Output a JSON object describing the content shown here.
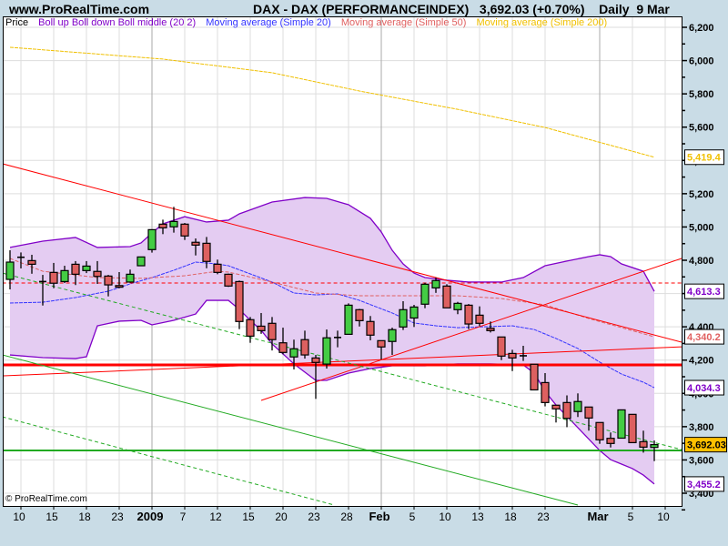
{
  "header": {
    "site": "www.ProRealTime.com",
    "instrument": "DAX - DAX (PERFORMANCEINDEX)",
    "quote": "3,692.03 (+0.70%)",
    "period": "Daily",
    "date": "9 Mar"
  },
  "legend": {
    "price": "Price",
    "bollinger": "Boll up Boll down Boll middle (20 2)",
    "ma20": "Moving average (Simple 20)",
    "ma50": "Moving average (Simple 50)",
    "ma200": "Moving average (Simple 200)"
  },
  "footer": "© ProRealTime.com",
  "colors": {
    "background": "#c9dce6",
    "up_candle": "#44cc44",
    "down_candle": "#dd6060",
    "bollinger_fill": "#e4ccf2",
    "bollinger_line": "#8000c8",
    "ma20": "#3333ff",
    "ma50": "#e06060",
    "ma200": "#f0c000",
    "trend_red": "#ff0000",
    "trend_green": "#22aa22",
    "last_price_bg": "#ffc000"
  },
  "chart_data": {
    "type": "candlestick",
    "ylim": [
      3400,
      6200
    ],
    "y_ticks": [
      "6,200",
      "6,000",
      "5,800",
      "5,600",
      "5,400",
      "5,200",
      "5,000",
      "4,800",
      "4,600",
      "4,400",
      "4,200",
      "4,000",
      "3,800",
      "3,600",
      "3,400"
    ],
    "y_tick_values": [
      6200,
      6000,
      5800,
      5600,
      5400,
      5200,
      5000,
      4800,
      4600,
      4400,
      4200,
      4000,
      3800,
      3600,
      3400
    ],
    "grid": true,
    "x_ticks": [
      {
        "label": "10",
        "bar": 1
      },
      {
        "label": "15",
        "bar": 4
      },
      {
        "label": "18",
        "bar": 7
      },
      {
        "label": "23",
        "bar": 10
      },
      {
        "label": "2009",
        "bar": 13,
        "major": true
      },
      {
        "label": "7",
        "bar": 16
      },
      {
        "label": "12",
        "bar": 19
      },
      {
        "label": "15",
        "bar": 22
      },
      {
        "label": "20",
        "bar": 25
      },
      {
        "label": "23",
        "bar": 28
      },
      {
        "label": "28",
        "bar": 31
      },
      {
        "label": "Feb",
        "bar": 34,
        "major": true
      },
      {
        "label": "5",
        "bar": 37
      },
      {
        "label": "10",
        "bar": 40
      },
      {
        "label": "13",
        "bar": 43
      },
      {
        "label": "18",
        "bar": 46
      },
      {
        "label": "23",
        "bar": 49
      },
      {
        "label": "Mar",
        "bar": 54,
        "major": true
      },
      {
        "label": "5",
        "bar": 57
      },
      {
        "label": "10",
        "bar": 60
      }
    ],
    "ohlc": [
      [
        4685,
        4860,
        4625,
        4789
      ],
      [
        4818,
        4847,
        4751,
        4818
      ],
      [
        4798,
        4833,
        4719,
        4776
      ],
      [
        4672,
        4712,
        4528,
        4668
      ],
      [
        4727,
        4784,
        4632,
        4662
      ],
      [
        4672,
        4767,
        4663,
        4738
      ],
      [
        4776,
        4795,
        4651,
        4716
      ],
      [
        4738,
        4795,
        4723,
        4765
      ],
      [
        4733,
        4795,
        4658,
        4703
      ],
      [
        4705,
        4712,
        4583,
        4652
      ],
      [
        4648,
        4729,
        4632,
        4638
      ],
      [
        4669,
        4744,
        4665,
        4716
      ],
      [
        4767,
        4820,
        4767,
        4820
      ],
      [
        4864,
        4984,
        4846,
        4984
      ],
      [
        5017,
        5044,
        4957,
        4995
      ],
      [
        5001,
        5121,
        4966,
        5033
      ],
      [
        5017,
        5024,
        4922,
        4946
      ],
      [
        4908,
        4931,
        4829,
        4891
      ],
      [
        4902,
        4940,
        4752,
        4793
      ],
      [
        4776,
        4804,
        4716,
        4727
      ],
      [
        4716,
        4720,
        4640,
        4645
      ],
      [
        4672,
        4678,
        4386,
        4432
      ],
      [
        4443,
        4459,
        4304,
        4344
      ],
      [
        4404,
        4483,
        4358,
        4377
      ],
      [
        4421,
        4459,
        4258,
        4323
      ],
      [
        4304,
        4395,
        4235,
        4246
      ],
      [
        4219,
        4323,
        4144,
        4268
      ],
      [
        4323,
        4377,
        4209,
        4231
      ],
      [
        4213,
        4231,
        3967,
        4186
      ],
      [
        4176,
        4384,
        4149,
        4334
      ],
      [
        4336,
        4377,
        4277,
        4334
      ],
      [
        4355,
        4541,
        4355,
        4530
      ],
      [
        4503,
        4508,
        4402,
        4437
      ],
      [
        4432,
        4465,
        4319,
        4350
      ],
      [
        4317,
        4317,
        4204,
        4279
      ],
      [
        4312,
        4395,
        4231,
        4383
      ],
      [
        4399,
        4554,
        4381,
        4503
      ],
      [
        4453,
        4532,
        4399,
        4519
      ],
      [
        4536,
        4665,
        4512,
        4656
      ],
      [
        4634,
        4696,
        4604,
        4678
      ],
      [
        4645,
        4656,
        4514,
        4514
      ],
      [
        4503,
        4550,
        4476,
        4541
      ],
      [
        4530,
        4537,
        4386,
        4417
      ],
      [
        4470,
        4523,
        4404,
        4421
      ],
      [
        4391,
        4432,
        4366,
        4377
      ],
      [
        4339,
        4339,
        4200,
        4224
      ],
      [
        4240,
        4262,
        4134,
        4213
      ],
      [
        4226,
        4286,
        4195,
        4222
      ],
      [
        4175,
        4175,
        4021,
        4021
      ],
      [
        4065,
        4122,
        3922,
        3945
      ],
      [
        3929,
        3929,
        3825,
        3907
      ],
      [
        3945,
        3988,
        3797,
        3850
      ],
      [
        3891,
        4000,
        3858,
        3951
      ],
      [
        3918,
        3918,
        3776,
        3852
      ],
      [
        3825,
        3825,
        3697,
        3721
      ],
      [
        3730,
        3765,
        3675,
        3699
      ],
      [
        3731,
        3901,
        3731,
        3901
      ],
      [
        3874,
        3874,
        3704,
        3704
      ],
      [
        3710,
        3776,
        3644,
        3677
      ],
      [
        3675,
        3717,
        3593,
        3692.03
      ]
    ],
    "bollinger_upper": [
      [
        0,
        4877
      ],
      [
        3,
        4915
      ],
      [
        6,
        4937
      ],
      [
        8,
        4877
      ],
      [
        11,
        4882
      ],
      [
        12,
        4904
      ],
      [
        13,
        4964
      ],
      [
        14,
        5019
      ],
      [
        16,
        5062
      ],
      [
        18,
        5030
      ],
      [
        20,
        5041
      ],
      [
        21,
        5079
      ],
      [
        24,
        5150
      ],
      [
        27,
        5177
      ],
      [
        29,
        5172
      ],
      [
        31,
        5134
      ],
      [
        33,
        5052
      ],
      [
        34,
        4970
      ],
      [
        35,
        4860
      ],
      [
        36,
        4778
      ],
      [
        37,
        4723
      ],
      [
        38,
        4696
      ],
      [
        40,
        4680
      ],
      [
        42,
        4669
      ],
      [
        45,
        4669
      ],
      [
        47,
        4696
      ],
      [
        49,
        4767
      ],
      [
        51,
        4795
      ],
      [
        53,
        4822
      ],
      [
        54,
        4833
      ],
      [
        55,
        4822
      ],
      [
        56,
        4778
      ],
      [
        58,
        4734
      ],
      [
        59,
        4613.3
      ]
    ],
    "bollinger_lower": [
      [
        0,
        4231
      ],
      [
        3,
        4215
      ],
      [
        6,
        4209
      ],
      [
        7,
        4220
      ],
      [
        8,
        4406
      ],
      [
        10,
        4434
      ],
      [
        12,
        4439
      ],
      [
        13,
        4412
      ],
      [
        15,
        4439
      ],
      [
        17,
        4477
      ],
      [
        18,
        4559
      ],
      [
        20,
        4559
      ],
      [
        21,
        4505
      ],
      [
        22,
        4439
      ],
      [
        23,
        4379
      ],
      [
        24,
        4297
      ],
      [
        26,
        4177
      ],
      [
        28,
        4078
      ],
      [
        29,
        4078
      ],
      [
        31,
        4122
      ],
      [
        33,
        4149
      ],
      [
        35,
        4166
      ],
      [
        38,
        4166
      ],
      [
        41,
        4177
      ],
      [
        44,
        4177
      ],
      [
        47,
        4171
      ],
      [
        48,
        4122
      ],
      [
        49,
        4012
      ],
      [
        50,
        3930
      ],
      [
        52,
        3794
      ],
      [
        54,
        3657
      ],
      [
        55,
        3602
      ],
      [
        56,
        3575
      ],
      [
        57,
        3548
      ],
      [
        58,
        3509
      ],
      [
        59,
        3455.2
      ]
    ],
    "ma20": [
      [
        0,
        4543
      ],
      [
        3,
        4548
      ],
      [
        6,
        4576
      ],
      [
        9,
        4614
      ],
      [
        11,
        4658
      ],
      [
        13,
        4696
      ],
      [
        15,
        4740
      ],
      [
        17,
        4789
      ],
      [
        19,
        4778
      ],
      [
        20,
        4767
      ],
      [
        24,
        4669
      ],
      [
        26,
        4603
      ],
      [
        28,
        4592
      ],
      [
        30,
        4598
      ],
      [
        32,
        4559
      ],
      [
        35,
        4483
      ],
      [
        37,
        4423
      ],
      [
        39,
        4406
      ],
      [
        41,
        4395
      ],
      [
        46,
        4406
      ],
      [
        48,
        4384
      ],
      [
        50,
        4330
      ],
      [
        52,
        4270
      ],
      [
        54,
        4188
      ],
      [
        56,
        4116
      ],
      [
        58,
        4067
      ],
      [
        59,
        4034.3
      ]
    ],
    "ma50": [
      [
        0,
        4811
      ],
      [
        3,
        4734
      ],
      [
        8,
        4696
      ],
      [
        12,
        4691
      ],
      [
        16,
        4707
      ],
      [
        19,
        4734
      ],
      [
        20,
        4729
      ],
      [
        24,
        4669
      ],
      [
        28,
        4603
      ],
      [
        32,
        4587
      ],
      [
        37,
        4587
      ],
      [
        41,
        4587
      ],
      [
        45,
        4570
      ],
      [
        49,
        4532
      ],
      [
        53,
        4450
      ],
      [
        59,
        4340.2
      ]
    ],
    "ma200": [
      [
        0,
        6080
      ],
      [
        14,
        6009
      ],
      [
        24,
        5927
      ],
      [
        32,
        5817
      ],
      [
        41,
        5707
      ],
      [
        49,
        5598
      ],
      [
        59,
        5419.4
      ]
    ],
    "trend_lines": [
      {
        "color": "red",
        "style": "solid",
        "width": 1,
        "from": [
          -0.7,
          5380
        ],
        "to": [
          61.5,
          4308
        ]
      },
      {
        "color": "red",
        "style": "solid",
        "width": 1,
        "from": [
          23,
          3958
        ],
        "to": [
          61.5,
          4811
        ]
      },
      {
        "color": "red",
        "style": "solid",
        "width": 3,
        "from": [
          -0.7,
          4171
        ],
        "to": [
          61.5,
          4171
        ]
      },
      {
        "color": "red",
        "style": "solid",
        "width": 1,
        "from": [
          -0.7,
          4105
        ],
        "to": [
          61.5,
          4280
        ]
      },
      {
        "color": "red",
        "style": "dashed",
        "width": 1,
        "from": [
          -0.7,
          4663
        ],
        "to": [
          61.5,
          4663
        ]
      },
      {
        "color": "green",
        "style": "solid",
        "width": 2,
        "from": [
          -0.7,
          3657
        ],
        "to": [
          61.5,
          3657
        ]
      },
      {
        "color": "green",
        "style": "solid",
        "width": 1,
        "from": [
          -0.7,
          4231
        ],
        "to": [
          52,
          3329
        ]
      },
      {
        "color": "green",
        "style": "dashed",
        "width": 1,
        "from": [
          -0.7,
          4723
        ],
        "to": [
          61.5,
          3662
        ]
      },
      {
        "color": "green",
        "style": "dashed",
        "width": 1,
        "from": [
          -0.7,
          3859
        ],
        "to": [
          29.7,
          3329
        ]
      }
    ],
    "value_labels": [
      {
        "text": "5,419.4",
        "value": 5419.4,
        "series": "ma200"
      },
      {
        "text": "4,613.3",
        "value": 4613.3,
        "series": "bollinger"
      },
      {
        "text": "4,340.2",
        "value": 4340.2,
        "series": "ma50"
      },
      {
        "text": "4,034.3",
        "value": 4034.3,
        "series": "bollinger"
      },
      {
        "text": "3,692.03",
        "value": 3692.03,
        "series": "price"
      },
      {
        "text": "3,455.2",
        "value": 3455.2,
        "series": "bollinger"
      }
    ]
  }
}
